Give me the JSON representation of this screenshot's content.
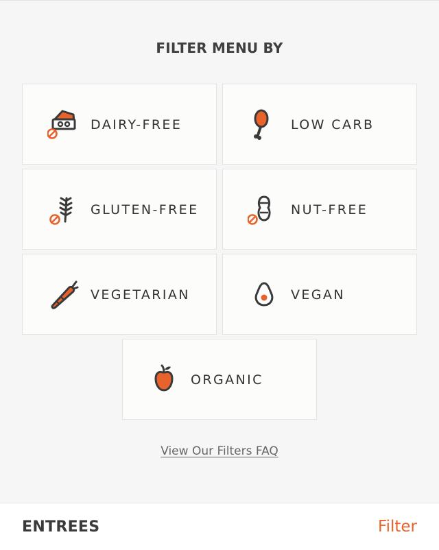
{
  "header": {
    "title": "FILTER MENU BY"
  },
  "filters": [
    {
      "label": "DAIRY-FREE",
      "icon": "cheese-no-icon"
    },
    {
      "label": "LOW CARB",
      "icon": "drumstick-icon"
    },
    {
      "label": "GLUTEN-FREE",
      "icon": "wheat-no-icon"
    },
    {
      "label": "NUT-FREE",
      "icon": "peanut-no-icon"
    },
    {
      "label": "VEGETARIAN",
      "icon": "carrot-icon"
    },
    {
      "label": "VEGAN",
      "icon": "avocado-icon"
    },
    {
      "label": "ORGANIC",
      "icon": "apple-icon"
    }
  ],
  "faq_link": "View Our Filters FAQ",
  "bottom_bar": {
    "section_label": "ENTREES",
    "filter_label": "Filter"
  },
  "colors": {
    "accent": "#e8622c",
    "icon_dark": "#3a3a3a",
    "tile_bg": "#fcfcfb",
    "page_bg": "#f6f6f6"
  }
}
